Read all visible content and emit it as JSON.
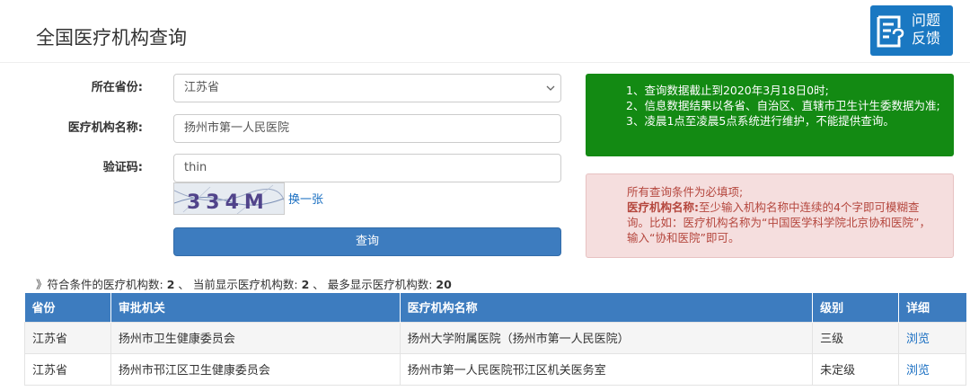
{
  "header": {
    "title": "全国医疗机构查询",
    "feedback_line1": "问题",
    "feedback_line2": "反馈"
  },
  "form": {
    "province_label": "所在省份:",
    "province_value": "江苏省",
    "institution_label": "医疗机构名称:",
    "institution_value": "扬州市第一人民医院",
    "captcha_label": "验证码:",
    "captcha_value": "thin",
    "captcha_image_text": "334M",
    "captcha_refresh": "换一张",
    "query_button": "查询"
  },
  "notice_green": {
    "line1": "1、查询数据截止到2020年3月18日0时;",
    "line2": "2、信息数据结果以各省、自治区、直辖市卫生计生委数据为准;",
    "line3": "3、凌晨1点至凌晨5点系统进行维护，不能提供查询。"
  },
  "notice_red": {
    "line1": "所有查询条件为必填项;",
    "bold_label": "医疗机构名称:",
    "line2": "至少输入机构名称中连续的4个字即可模糊查询。比如：医疗机构名称为“中国医学科学院北京协和医院”，输入“协和医院”即可。"
  },
  "summary": {
    "prefix": "》符合条件的医疗机构数:",
    "matched": "2",
    "sep1": "、 当前显示医疗机构数:",
    "shown": "2",
    "sep2": "、 最多显示医疗机构数:",
    "max": "20"
  },
  "table": {
    "headers": [
      "省份",
      "审批机关",
      "医疗机构名称",
      "级别",
      "详细"
    ],
    "rows": [
      [
        "江苏省",
        "扬州市卫生健康委员会",
        "扬州大学附属医院（扬州市第一人民医院）",
        "三级",
        "浏览"
      ],
      [
        "江苏省",
        "扬州市邗江区卫生健康委员会",
        "扬州市第一人民医院邗江区机关医务室",
        "未定级",
        "浏览"
      ]
    ]
  },
  "colors": {
    "primary": "#3d7cbf",
    "notice_green": "#138a13",
    "notice_red_bg": "#f5dede",
    "notice_red_text": "#b5473e",
    "feedback": "#1a78c2",
    "link": "#1a6fc2"
  },
  "icons": {
    "feedback": "feedback-form-icon",
    "select": "chevron-down-icon"
  }
}
